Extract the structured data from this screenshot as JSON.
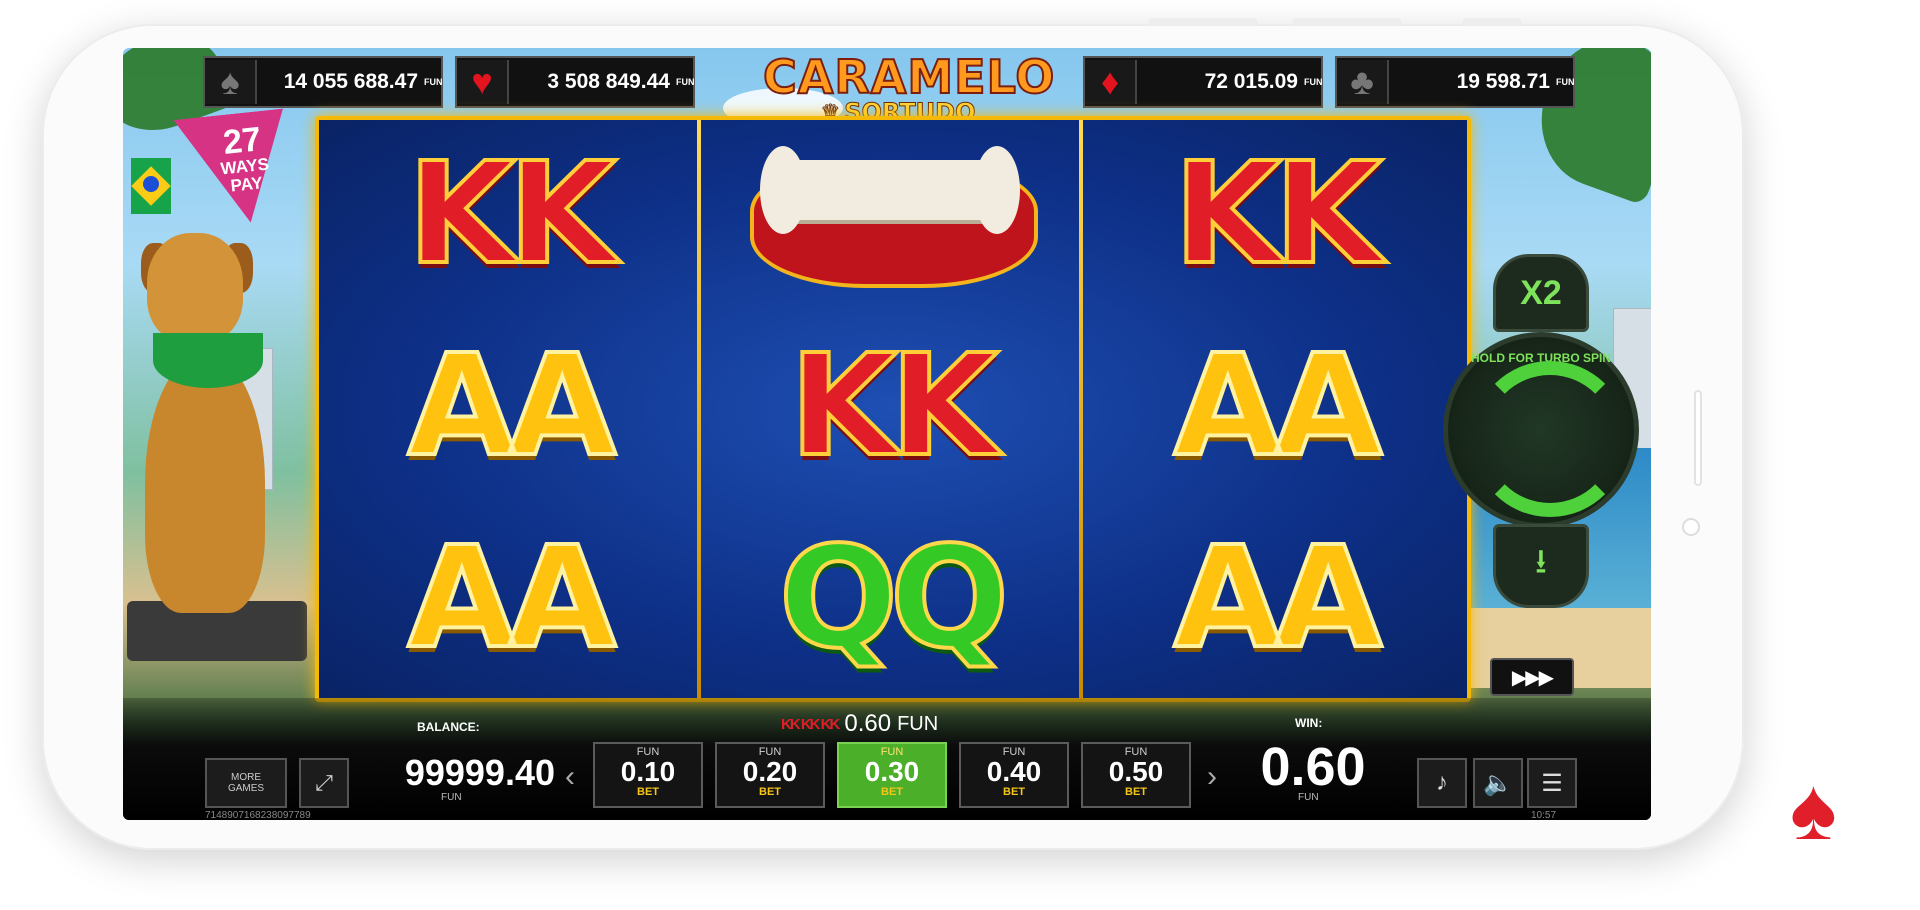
{
  "jackpots": [
    {
      "suit_icon": "spade-icon",
      "glyph": "♠",
      "value": "14 055 688.47",
      "currency": "FUN"
    },
    {
      "suit_icon": "heart-icon",
      "glyph": "♥",
      "value": "3 508 849.44",
      "currency": "FUN"
    },
    {
      "suit_icon": "diamond-icon",
      "glyph": "♦",
      "value": "72 015.09",
      "currency": "FUN"
    },
    {
      "suit_icon": "club-icon",
      "glyph": "♣",
      "value": "19 598.71",
      "currency": "FUN"
    }
  ],
  "logo": {
    "line1": "CARAMELO",
    "line2": "SORTUDO"
  },
  "ways_badge": {
    "number": "27",
    "line1": "WAYS",
    "line2": "PAY"
  },
  "reels": [
    [
      "KK",
      "AA",
      "AA"
    ],
    [
      "bone-symbol",
      "KK",
      "QQ"
    ],
    [
      "KK",
      "AA",
      "AA"
    ]
  ],
  "controls": {
    "multiplier": "X2",
    "spin_hint": "HOLD FOR TURBO SPIN",
    "autoplay_glyph": "▶▶▶"
  },
  "lines_info": {
    "amount": "0.60",
    "currency": "FUN"
  },
  "balance": {
    "label": "BALANCE:",
    "value": "99999.40",
    "currency": "FUN"
  },
  "more_games": {
    "line1": "MORE",
    "line2": "GAMES"
  },
  "bets": [
    {
      "top": "FUN",
      "value": "0.10",
      "label": "BET",
      "selected": false
    },
    {
      "top": "FUN",
      "value": "0.20",
      "label": "BET",
      "selected": false
    },
    {
      "top": "FUN",
      "value": "0.30",
      "label": "BET",
      "selected": true
    },
    {
      "top": "FUN",
      "value": "0.40",
      "label": "BET",
      "selected": false
    },
    {
      "top": "FUN",
      "value": "0.50",
      "label": "BET",
      "selected": false
    }
  ],
  "win": {
    "label": "WIN:",
    "value": "0.60",
    "currency": "FUN"
  },
  "footer": {
    "id": "7148907168238097789",
    "time": "10:57"
  },
  "colors": {
    "accent_green": "#4caf2a",
    "reel_border": "#f5b90a",
    "brand_red": "#e01f2b"
  }
}
